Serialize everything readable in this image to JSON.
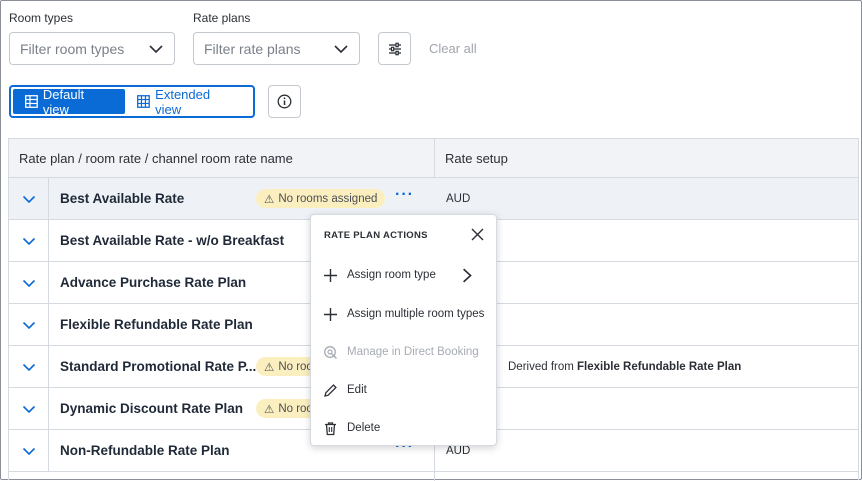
{
  "filters": {
    "room_types": {
      "label": "Room types",
      "placeholder": "Filter room types"
    },
    "rate_plans": {
      "label": "Rate plans",
      "placeholder": "Filter rate plans"
    },
    "clear_all": "Clear all"
  },
  "views": {
    "default": "Default view",
    "extended": "Extended view",
    "active": "default"
  },
  "table": {
    "columns": [
      "Rate plan / room rate / channel room rate name",
      "Rate setup"
    ],
    "rows": [
      {
        "name": "Best Available Rate",
        "badge": "No rooms assigned",
        "setup": "AUD",
        "setup_bold": ""
      },
      {
        "name": "Best Available Rate - w/o Breakfast",
        "badge": "",
        "setup": "",
        "setup_bold": ""
      },
      {
        "name": "Advance Purchase Rate Plan",
        "badge": "",
        "setup": "",
        "setup_bold": ""
      },
      {
        "name": "Flexible Refundable Rate Plan",
        "badge": "",
        "setup": "",
        "setup_bold": ""
      },
      {
        "name": "Standard Promotional Rate P...",
        "badge": "No roo",
        "setup": "Derived from ",
        "setup_bold": "Flexible Refundable Rate Plan"
      },
      {
        "name": "Dynamic Discount Rate Plan",
        "badge": "No roo",
        "setup": "",
        "setup_bold": ""
      },
      {
        "name": "Non-Refundable Rate Plan",
        "badge": "",
        "setup": "AUD",
        "setup_bold": ""
      }
    ]
  },
  "popup": {
    "title": "RATE PLAN ACTIONS",
    "items": [
      {
        "label": "Assign room type",
        "icon": "plus-icon",
        "disabled": false,
        "submenu": true
      },
      {
        "label": "Assign multiple room types",
        "icon": "plus-icon",
        "disabled": false,
        "submenu": false
      },
      {
        "label": "Manage in Direct Booking",
        "icon": "booking-icon",
        "disabled": true,
        "submenu": false
      },
      {
        "label": "Edit",
        "icon": "pencil-icon",
        "disabled": false,
        "submenu": false
      },
      {
        "label": "Delete",
        "icon": "trash-icon",
        "disabled": false,
        "submenu": false
      }
    ]
  },
  "colors": {
    "accent": "#0b6bd6",
    "badge_bg": "#fbefc0",
    "header_bg": "#f1f3f6"
  }
}
